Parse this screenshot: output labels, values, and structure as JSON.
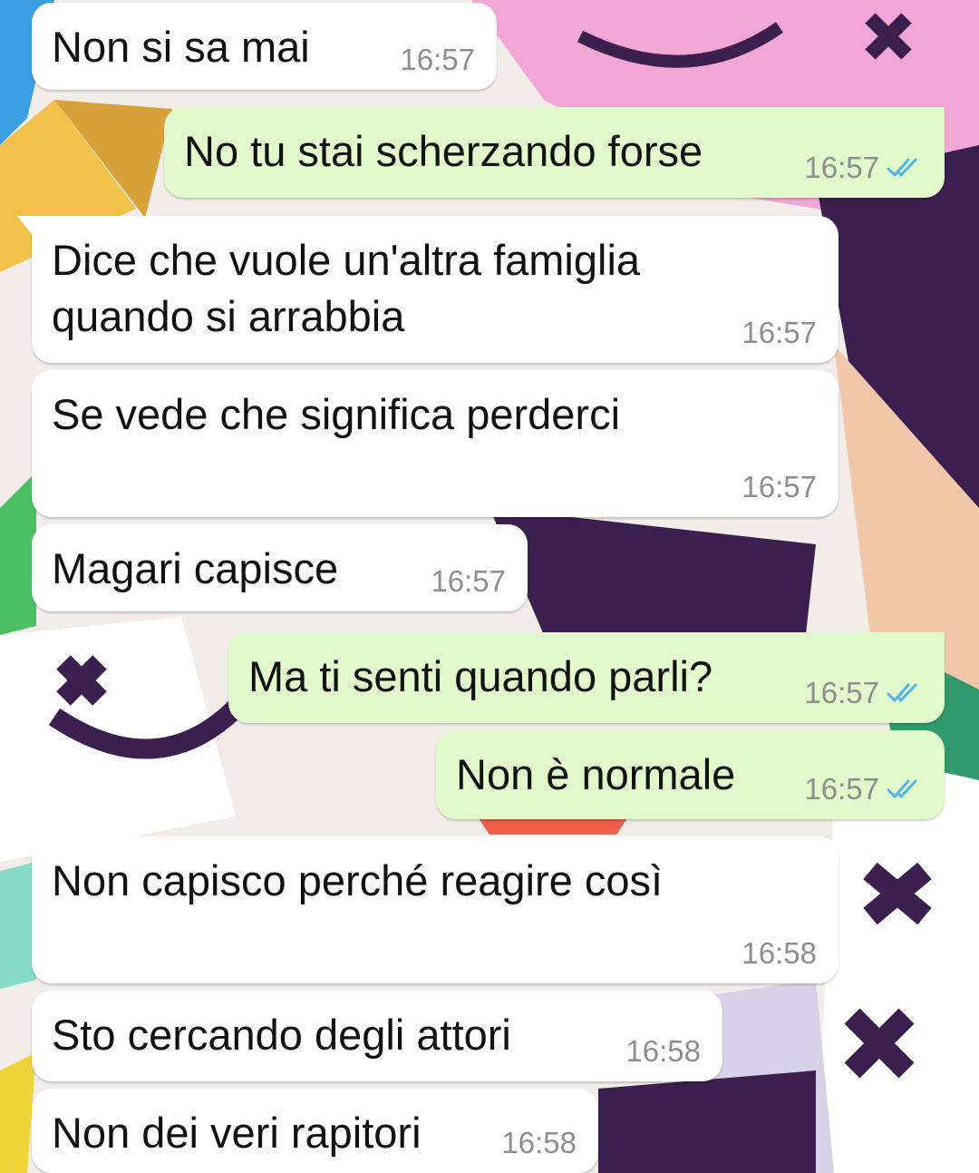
{
  "conversation": {
    "messages": [
      {
        "text": "Non si sa mai",
        "time": "16:57",
        "direction": "in"
      },
      {
        "text": "No tu stai scherzando forse",
        "time": "16:57",
        "direction": "out",
        "status": "read-double-check-icon"
      },
      {
        "text": "Dice che vuole un'altra famiglia\nquando si arrabbia",
        "time": "16:57",
        "direction": "in"
      },
      {
        "text": "Se vede che significa perderci",
        "time": "16:57",
        "direction": "in"
      },
      {
        "text": "Magari capisce",
        "time": "16:57",
        "direction": "in"
      },
      {
        "text": "Ma ti senti quando parli?",
        "time": "16:57",
        "direction": "out",
        "status": "read-double-check-icon"
      },
      {
        "text": "Non è normale",
        "time": "16:57",
        "direction": "out",
        "status": "read-double-check-icon"
      },
      {
        "text": "Non capisco perché reagire così",
        "time": "16:58",
        "direction": "in"
      },
      {
        "text": "Sto cercando degli attori",
        "time": "16:58",
        "direction": "in"
      },
      {
        "text": "Non dei veri rapitori",
        "time": "16:58",
        "direction": "in"
      }
    ]
  },
  "colors": {
    "incoming_bubble": "#ffffff",
    "outgoing_bubble": "#e2f9cc",
    "read_ticks": "#4fb6ec",
    "timestamp": "#8e8e8e"
  }
}
